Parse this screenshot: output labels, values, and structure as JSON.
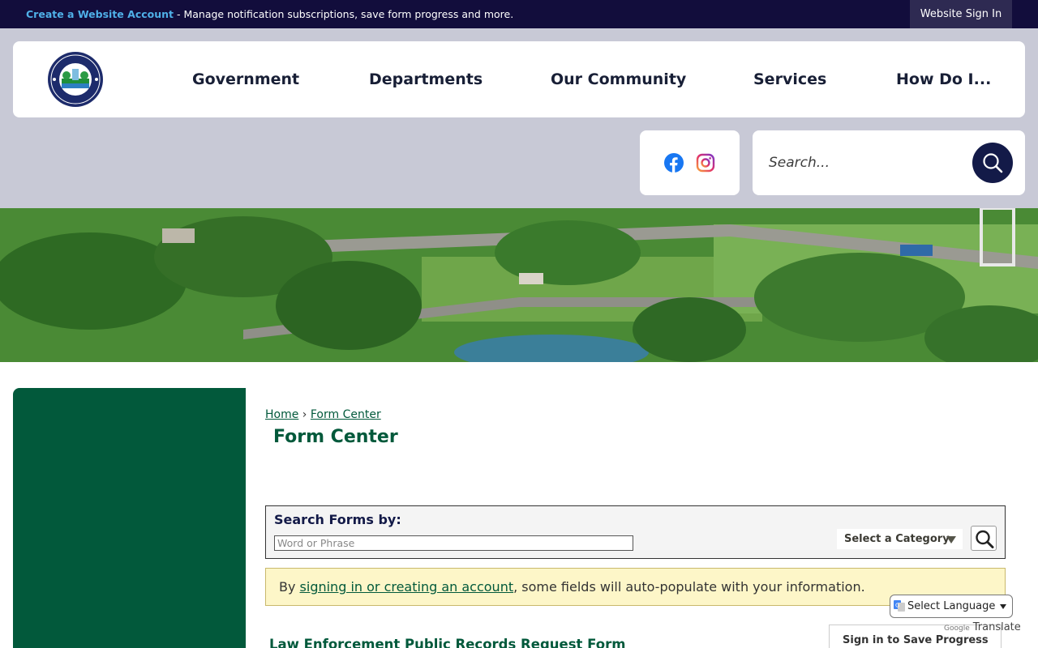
{
  "topbar": {
    "create_link": "Create a Website Account",
    "create_desc": " - Manage notification subscriptions, save form progress and more.",
    "signin_label": "Website Sign In"
  },
  "header": {
    "logo_alt": "City of Belleview seal",
    "nav": [
      "Government",
      "Departments",
      "Our Community",
      "Services",
      "How Do I..."
    ]
  },
  "social": {
    "facebook_icon": "facebook-icon",
    "instagram_icon": "instagram-icon"
  },
  "search": {
    "placeholder": "Search..."
  },
  "breadcrumb": {
    "home": "Home",
    "sep": "›",
    "current": "Form Center"
  },
  "page": {
    "title": "Form Center"
  },
  "formsearch": {
    "label": "Search Forms by:",
    "input_placeholder": "Word or Phrase",
    "category_label": "Select a Category"
  },
  "notice": {
    "prefix": "By ",
    "link": "signing in or creating an account",
    "suffix": ", some fields will auto-populate with your information."
  },
  "forms": {
    "first_title": "Law Enforcement Public Records Request Form",
    "save_button": "Sign in to Save Progress"
  },
  "translate": {
    "select_label": "Select Language",
    "powered_google": "Google",
    "powered_translate": "Translate"
  },
  "colors": {
    "topbar": "#120d3c",
    "navy": "#131a48",
    "green": "#02593b",
    "link_blue": "#4fb0e8"
  }
}
